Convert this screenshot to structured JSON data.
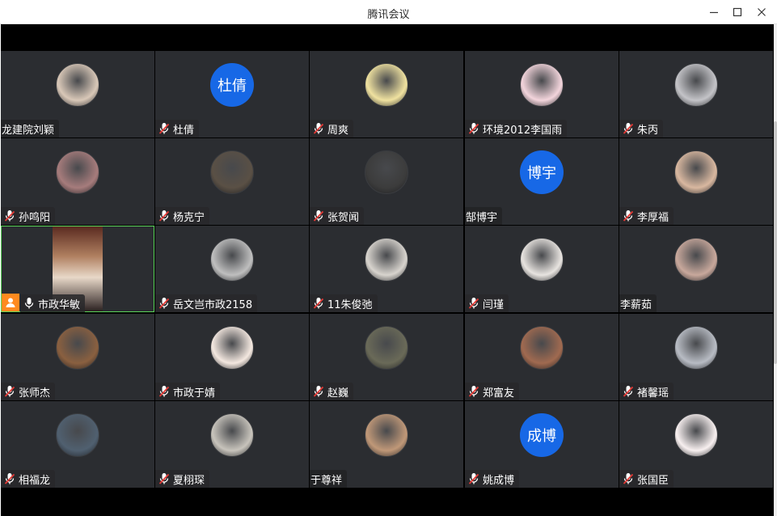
{
  "window": {
    "title": "腾讯会议"
  },
  "participants": [
    {
      "name": "龙建院刘颖",
      "muted": false,
      "initials": "",
      "avatar_color": "#d9c8b8"
    },
    {
      "name": "杜倩",
      "muted": true,
      "initials": "杜倩",
      "avatar_color": "#1768e6"
    },
    {
      "name": "周爽",
      "muted": true,
      "initials": "",
      "avatar_color": "#f0e2a0"
    },
    {
      "name": "环境2012李国雨",
      "muted": true,
      "initials": "",
      "avatar_color": "#f3d5dc"
    },
    {
      "name": "朱丙",
      "muted": true,
      "initials": "",
      "avatar_color": "#c4c4c8"
    },
    {
      "name": "孙鸣阳",
      "muted": true,
      "initials": "",
      "avatar_color": "#a67c7c"
    },
    {
      "name": "杨克宁",
      "muted": true,
      "initials": "",
      "avatar_color": "#5a5045"
    },
    {
      "name": "张贺闻",
      "muted": true,
      "initials": "",
      "avatar_color": "#3c3c3c"
    },
    {
      "name": "郜博宇",
      "muted": false,
      "initials": "博宇",
      "avatar_color": "#1768e6"
    },
    {
      "name": "李厚福",
      "muted": true,
      "initials": "",
      "avatar_color": "#d9b8a0"
    },
    {
      "name": "市政华敏",
      "muted": false,
      "initials": "",
      "avatar_color": "#b08060",
      "video": true,
      "host": true
    },
    {
      "name": "岳文岂市政2158",
      "muted": true,
      "initials": "",
      "avatar_color": "#bfbfbf"
    },
    {
      "name": "11朱俊弛",
      "muted": true,
      "initials": "",
      "avatar_color": "#d8d4ce"
    },
    {
      "name": "闫瑾",
      "muted": true,
      "initials": "",
      "avatar_color": "#e8e4e0"
    },
    {
      "name": "李薪茹",
      "muted": false,
      "initials": "",
      "avatar_color": "#c8a89c"
    },
    {
      "name": "张师杰",
      "muted": true,
      "initials": "",
      "avatar_color": "#8a6040"
    },
    {
      "name": "市政于婧",
      "muted": true,
      "initials": "",
      "avatar_color": "#f4e8e0"
    },
    {
      "name": "赵巍",
      "muted": true,
      "initials": "",
      "avatar_color": "#6a6a58"
    },
    {
      "name": "郑富友",
      "muted": true,
      "initials": "",
      "avatar_color": "#a06a50"
    },
    {
      "name": "褚馨瑶",
      "muted": true,
      "initials": "",
      "avatar_color": "#b8bcc4"
    },
    {
      "name": "相福龙",
      "muted": true,
      "initials": "",
      "avatar_color": "#506070"
    },
    {
      "name": "夏栩琛",
      "muted": true,
      "initials": "",
      "avatar_color": "#c8c4bc"
    },
    {
      "name": "于尊祥",
      "muted": false,
      "initials": "",
      "avatar_color": "#c09878"
    },
    {
      "name": "姚成博",
      "muted": true,
      "initials": "成博",
      "avatar_color": "#1768e6"
    },
    {
      "name": "张国臣",
      "muted": true,
      "initials": "",
      "avatar_color": "#f8f0f0"
    }
  ]
}
